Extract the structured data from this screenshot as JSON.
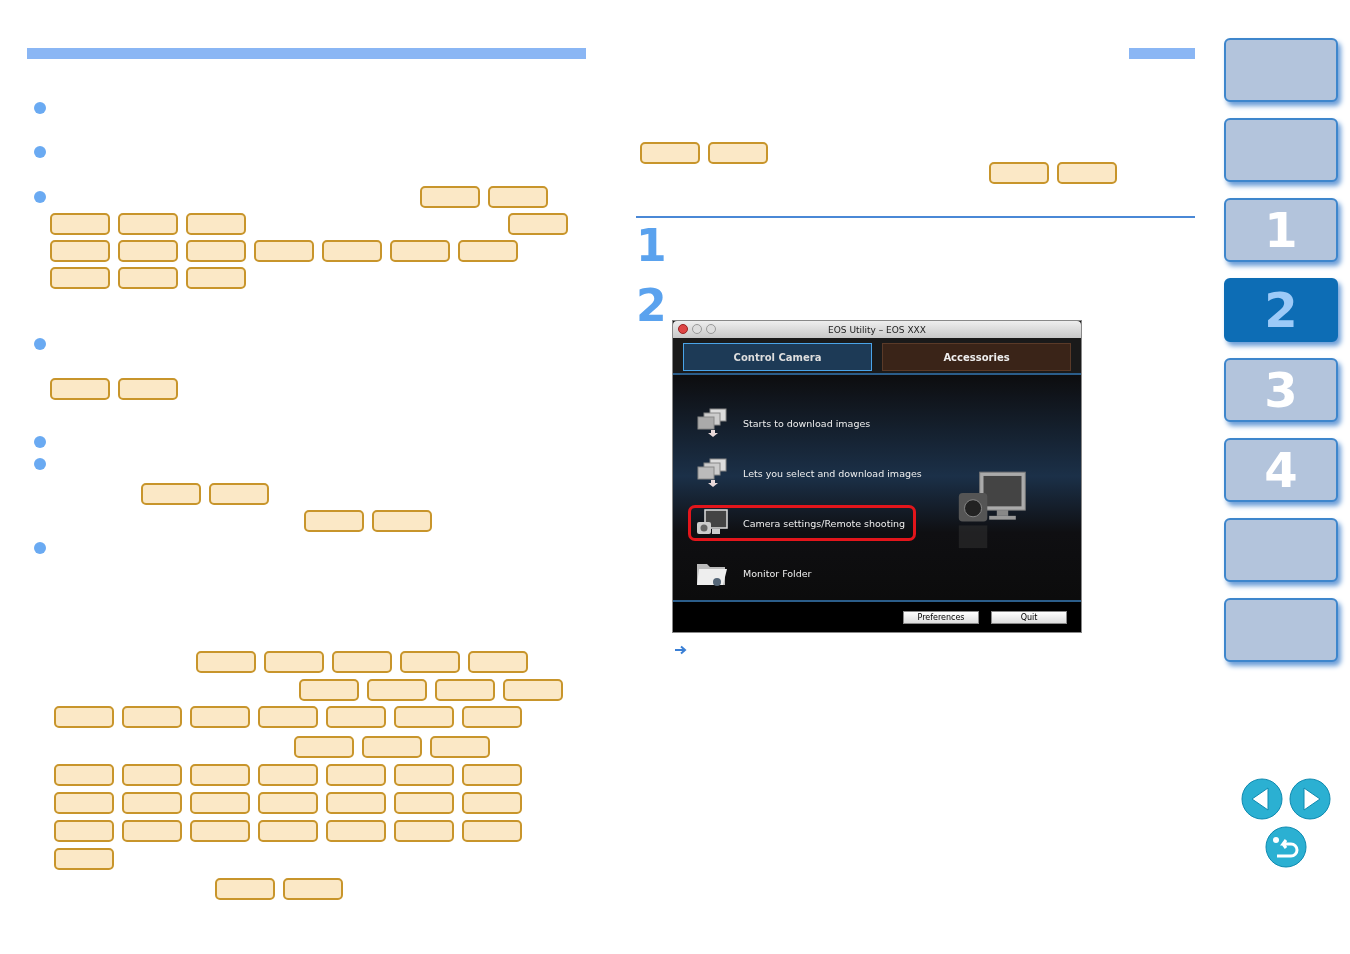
{
  "steps": [
    "1",
    "2"
  ],
  "app_window": {
    "title": "EOS Utility – EOS XXX",
    "tabs": [
      {
        "label": "Control Camera",
        "selected": true
      },
      {
        "label": "Accessories",
        "selected": false
      }
    ],
    "items": [
      {
        "kind": "download",
        "label": "Starts to download images",
        "highlighted": false
      },
      {
        "kind": "select",
        "label": "Lets you select and download images",
        "highlighted": false
      },
      {
        "kind": "camera",
        "label": "Camera settings/Remote shooting",
        "highlighted": true
      },
      {
        "kind": "folder",
        "label": "Monitor Folder",
        "highlighted": false
      }
    ],
    "buttons": [
      "Preferences",
      "Quit"
    ]
  },
  "sidebar": {
    "tabs": [
      {
        "selected": false
      },
      {
        "selected": false
      },
      {
        "label": "1",
        "selected": false
      },
      {
        "label": "2",
        "selected": true
      },
      {
        "label": "3",
        "selected": false
      },
      {
        "label": "4",
        "selected": false
      },
      {
        "selected": false
      },
      {
        "selected": false
      }
    ]
  }
}
